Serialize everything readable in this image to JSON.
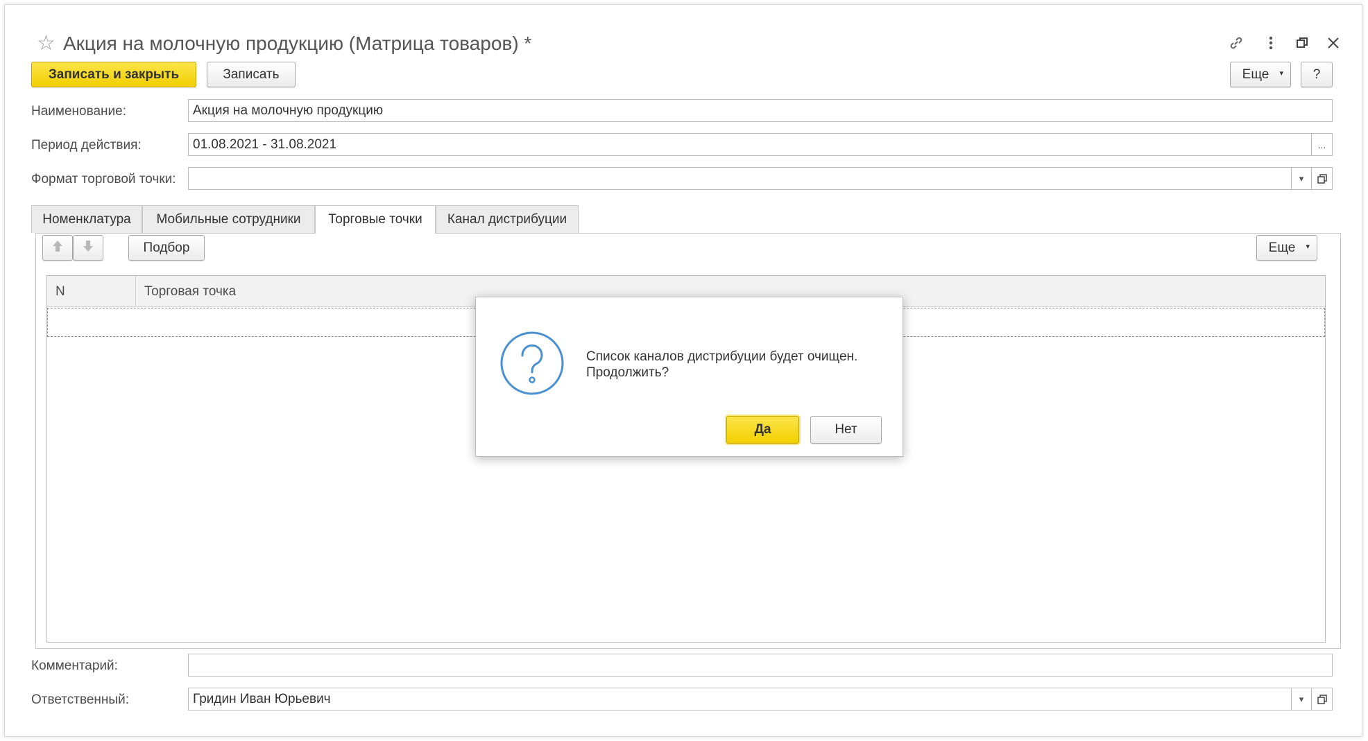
{
  "window": {
    "title": "Акция на молочную продукцию (Матрица товаров) *",
    "favorite_icon": "star-icon",
    "controls": [
      "link-icon",
      "more-vertical-icon",
      "restore-icon",
      "close-icon"
    ]
  },
  "toolbar": {
    "save_close_label": "Записать и закрыть",
    "save_label": "Записать",
    "more_label": "Еще",
    "help_label": "?"
  },
  "form": {
    "name_label": "Наименование:",
    "name_value": "Акция на молочную продукцию",
    "period_label": "Период действия:",
    "period_value": "01.08.2021 - 31.08.2021",
    "period_button": "...",
    "format_label": "Формат торговой точки:",
    "format_value": "",
    "comment_label": "Комментарий:",
    "comment_value": "",
    "responsible_label": "Ответственный:",
    "responsible_value": "Гридин Иван Юрьевич"
  },
  "tabs": [
    {
      "label": "Номенклатура",
      "active": false
    },
    {
      "label": "Мобильные сотрудники",
      "active": false
    },
    {
      "label": "Торговые точки",
      "active": true
    },
    {
      "label": "Канал дистрибуции",
      "active": false
    }
  ],
  "table_toolbar": {
    "pick_label": "Подбор",
    "more_label": "Еще"
  },
  "table": {
    "columns": [
      "N",
      "Торговая точка"
    ]
  },
  "dialog": {
    "message_line1": "Список каналов дистрибуции будет очищен.",
    "message_line2": "Продолжить?",
    "yes_label": "Да",
    "no_label": "Нет",
    "icon": "question-icon"
  },
  "colors": {
    "accent_yellow": "#f5d400",
    "dialog_icon": "#4a8fd0"
  }
}
